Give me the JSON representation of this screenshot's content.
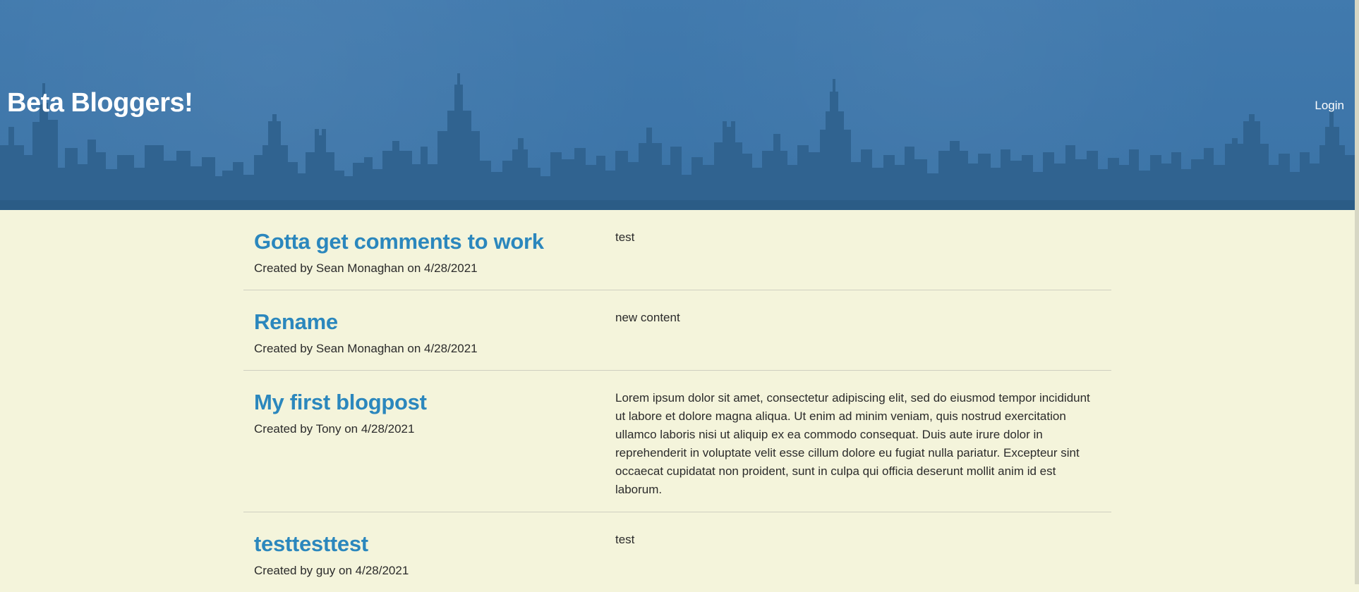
{
  "header": {
    "title": "Beta Bloggers!",
    "login_label": "Login",
    "background_color": "#3d77ac",
    "skyline_color": "#2f628e"
  },
  "posts": [
    {
      "title": "Gotta get comments to work",
      "meta": "Created by Sean Monaghan on 4/28/2021",
      "content": "test"
    },
    {
      "title": "Rename",
      "meta": "Created by Sean Monaghan on 4/28/2021",
      "content": "new content"
    },
    {
      "title": "My first blogpost",
      "meta": "Created by Tony on 4/28/2021",
      "content": "Lorem ipsum dolor sit amet, consectetur adipiscing elit, sed do eiusmod tempor incididunt ut labore et dolore magna aliqua. Ut enim ad minim veniam, quis nostrud exercitation ullamco laboris nisi ut aliquip ex ea commodo consequat. Duis aute irure dolor in reprehenderit in voluptate velit esse cillum dolore eu fugiat nulla pariatur. Excepteur sint occaecat cupidatat non proident, sunt in culpa qui officia deserunt mollit anim id est laborum."
    },
    {
      "title": "testtesttest",
      "meta": "Created by guy on 4/28/2021",
      "content": "test"
    }
  ],
  "colors": {
    "page_background": "#f4f4db",
    "post_title": "#2b87bd",
    "divider": "#cfcfc0"
  }
}
